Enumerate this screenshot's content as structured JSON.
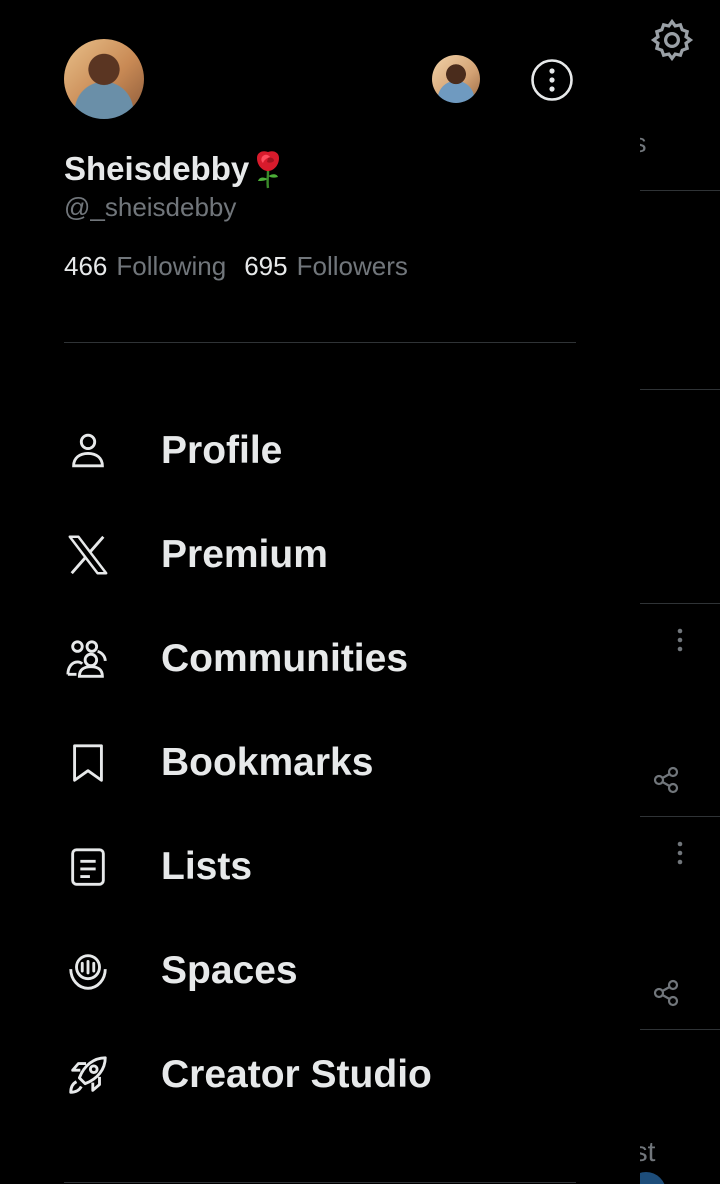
{
  "profile": {
    "display_name": "Sheisdebby",
    "name_emoji": "rose-emoji",
    "handle": "@_sheisdebby",
    "following_count": "466",
    "following_label": "Following",
    "followers_count": "695",
    "followers_label": "Followers"
  },
  "menu": {
    "items": [
      {
        "label": "Profile",
        "icon": "person-icon"
      },
      {
        "label": "Premium",
        "icon": "x-logo-icon"
      },
      {
        "label": "Communities",
        "icon": "people-icon"
      },
      {
        "label": "Bookmarks",
        "icon": "bookmark-icon"
      },
      {
        "label": "Lists",
        "icon": "list-icon"
      },
      {
        "label": "Spaces",
        "icon": "spaces-icon"
      },
      {
        "label": "Creator Studio",
        "icon": "rocket-icon"
      }
    ]
  },
  "background": {
    "tab_text_fragment": "ns",
    "bottom_text_fragment": "ost"
  },
  "colors": {
    "background": "#000000",
    "primary_text": "#e7e9ea",
    "secondary_text": "#71767b",
    "divider": "#2f3336"
  }
}
